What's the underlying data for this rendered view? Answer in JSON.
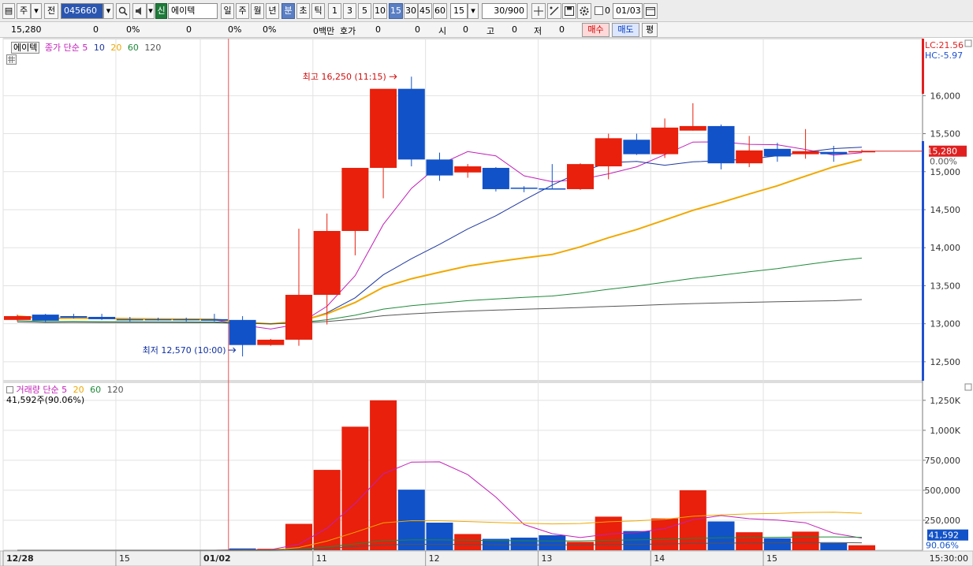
{
  "toolbar": {
    "menu_glyph": "▤",
    "type_label": "주",
    "prev_label": "전",
    "code": "045660",
    "badge": "신",
    "stock_name": "에이텍",
    "periods": [
      "일",
      "주",
      "월",
      "년",
      "분",
      "초",
      "틱"
    ],
    "intervals": [
      "1",
      "3",
      "5",
      "10",
      "15",
      "30",
      "45",
      "60"
    ],
    "interval_input": "15",
    "count": "30/900",
    "date": "01/03",
    "checkbox_label": "0",
    "colors": {
      "selected": "#5b7fc4"
    }
  },
  "quote": {
    "price": "15,280",
    "change": "0",
    "change_pct": "0%",
    "volume": "0",
    "volume_pct": "0%",
    "pct3": "0%",
    "amount": "0백만",
    "bid_label": "호가",
    "bid1": "0",
    "bid2": "0",
    "open_label": "시",
    "open": "0",
    "high_label": "고",
    "high": "0",
    "low_label": "저",
    "low": "0",
    "buy_label": "매수",
    "sell_label": "매도",
    "avg_label": "평"
  },
  "price_panel": {
    "name_tag": "에이텍",
    "legend_prefix": "종가 단순",
    "ma_periods": [
      "5",
      "10",
      "20",
      "60",
      "120"
    ],
    "ma_colors": [
      "#c21fb8",
      "#1e38a0",
      "#f0a800",
      "#1f8a3a",
      "#555555"
    ],
    "lc": "LC:21.56",
    "hc": "HC:-5.97",
    "last_price": "15,280",
    "last_pct": "0.00%",
    "high_note": "최고 16,250 (11:15)",
    "low_note": "최저 12,570 (10:00)",
    "y_ticks": [
      "16,000",
      "15,500",
      "15,000",
      "14,500",
      "14,000",
      "13,500",
      "13,000",
      "12,500"
    ]
  },
  "volume_panel": {
    "legend_prefix": "거래량 단순",
    "ma_periods": [
      "5",
      "20",
      "60",
      "120"
    ],
    "ma_colors": [
      "#c21fb8",
      "#f0a800",
      "#1f8a3a",
      "#555555"
    ],
    "current": "41,592주(90.06%)",
    "last_value": "41,592",
    "last_pct": "90.06%",
    "y_ticks": [
      "1,250K",
      "1,000K",
      "750,000",
      "500,000",
      "250,000"
    ]
  },
  "x_axis": {
    "labels": [
      "12/28",
      "15",
      "01/02",
      "11",
      "12",
      "13",
      "14",
      "15"
    ],
    "time": "15:30:00"
  },
  "chart_data": {
    "type": "candlestick",
    "candles": [
      {
        "o": 13050,
        "h": 13120,
        "l": 13030,
        "c": 13100
      },
      {
        "o": 13120,
        "h": 13130,
        "l": 13020,
        "c": 13040
      },
      {
        "o": 13100,
        "h": 13130,
        "l": 13070,
        "c": 13080
      },
      {
        "o": 13090,
        "h": 13130,
        "l": 13050,
        "c": 13060
      },
      {
        "o": 13060,
        "h": 13090,
        "l": 13030,
        "c": 13050
      },
      {
        "o": 13060,
        "h": 13080,
        "l": 13040,
        "c": 13050
      },
      {
        "o": 13060,
        "h": 13080,
        "l": 13030,
        "c": 13050
      },
      {
        "o": 13060,
        "h": 13130,
        "l": 13030,
        "c": 13040
      },
      {
        "o": 13050,
        "h": 13100,
        "l": 12570,
        "c": 12720
      },
      {
        "o": 12720,
        "h": 12800,
        "l": 12710,
        "c": 12790
      },
      {
        "o": 12790,
        "h": 14250,
        "l": 12710,
        "c": 13380
      },
      {
        "o": 13380,
        "h": 14450,
        "l": 12990,
        "c": 14220
      },
      {
        "o": 14220,
        "h": 14850,
        "l": 13900,
        "c": 15050
      },
      {
        "o": 15050,
        "h": 15400,
        "l": 14650,
        "c": 16090
      },
      {
        "o": 16090,
        "h": 16250,
        "l": 15070,
        "c": 15160
      },
      {
        "o": 15160,
        "h": 15250,
        "l": 14880,
        "c": 14950
      },
      {
        "o": 14990,
        "h": 15100,
        "l": 14920,
        "c": 15070
      },
      {
        "o": 15050,
        "h": 15060,
        "l": 14740,
        "c": 14770
      },
      {
        "o": 14790,
        "h": 14810,
        "l": 14730,
        "c": 14780
      },
      {
        "o": 14780,
        "h": 15100,
        "l": 14770,
        "c": 14770
      },
      {
        "o": 14770,
        "h": 15110,
        "l": 14760,
        "c": 15100
      },
      {
        "o": 15070,
        "h": 15500,
        "l": 14900,
        "c": 15440
      },
      {
        "o": 15420,
        "h": 15500,
        "l": 15220,
        "c": 15230
      },
      {
        "o": 15230,
        "h": 15700,
        "l": 15180,
        "c": 15580
      },
      {
        "o": 15540,
        "h": 15900,
        "l": 15540,
        "c": 15600
      },
      {
        "o": 15600,
        "h": 15620,
        "l": 15030,
        "c": 15110
      },
      {
        "o": 15110,
        "h": 15470,
        "l": 15060,
        "c": 15280
      },
      {
        "o": 15300,
        "h": 15380,
        "l": 15130,
        "c": 15200
      },
      {
        "o": 15230,
        "h": 15560,
        "l": 15170,
        "c": 15270
      },
      {
        "o": 15260,
        "h": 15340,
        "l": 15130,
        "c": 15230
      },
      {
        "o": 15260,
        "h": 15290,
        "l": 15250,
        "c": 15270
      }
    ],
    "volume": [
      0,
      0,
      0,
      0,
      0,
      0,
      0,
      0,
      15000,
      12000,
      220000,
      670000,
      1030000,
      1250000,
      505000,
      230000,
      135000,
      95000,
      105000,
      125000,
      70000,
      280000,
      160000,
      265000,
      500000,
      240000,
      150000,
      100000,
      155000,
      60000,
      41592
    ],
    "ylim_price": [
      12250,
      16750
    ],
    "ylim_volume": [
      0,
      1400000
    ]
  }
}
